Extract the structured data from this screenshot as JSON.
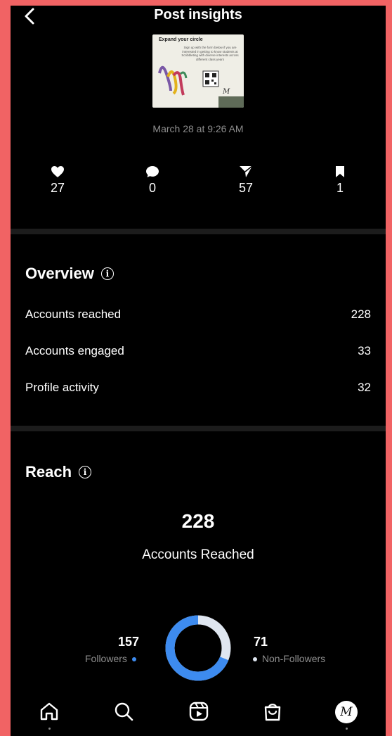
{
  "header": {
    "title": "Post insights",
    "back_icon": "chevron-left-icon"
  },
  "post": {
    "thumbnail": {
      "heading": "Expand your circle",
      "body": "Sign up with the form below if you are interested in getting to know students at Scribbleting with diverse interests across different class years"
    },
    "timestamp": "March 28 at 9:26 AM"
  },
  "interactions": [
    {
      "icon": "heart-icon",
      "value": "27"
    },
    {
      "icon": "comment-icon",
      "value": "0"
    },
    {
      "icon": "send-icon",
      "value": "57"
    },
    {
      "icon": "bookmark-icon",
      "value": "1"
    }
  ],
  "overview": {
    "title": "Overview",
    "rows": [
      {
        "label": "Accounts reached",
        "value": "228"
      },
      {
        "label": "Accounts engaged",
        "value": "33"
      },
      {
        "label": "Profile activity",
        "value": "32"
      }
    ]
  },
  "reach": {
    "title": "Reach",
    "total": "228",
    "total_label": "Accounts Reached",
    "followers": {
      "value": "157",
      "label": "Followers"
    },
    "non_followers": {
      "value": "71",
      "label": "Non-Followers"
    },
    "colors": {
      "followers": "#3d8bef",
      "non_followers": "#dfe6f0"
    }
  },
  "nav": [
    "home-icon",
    "search-icon",
    "reels-icon",
    "shop-icon",
    "profile-avatar"
  ]
}
